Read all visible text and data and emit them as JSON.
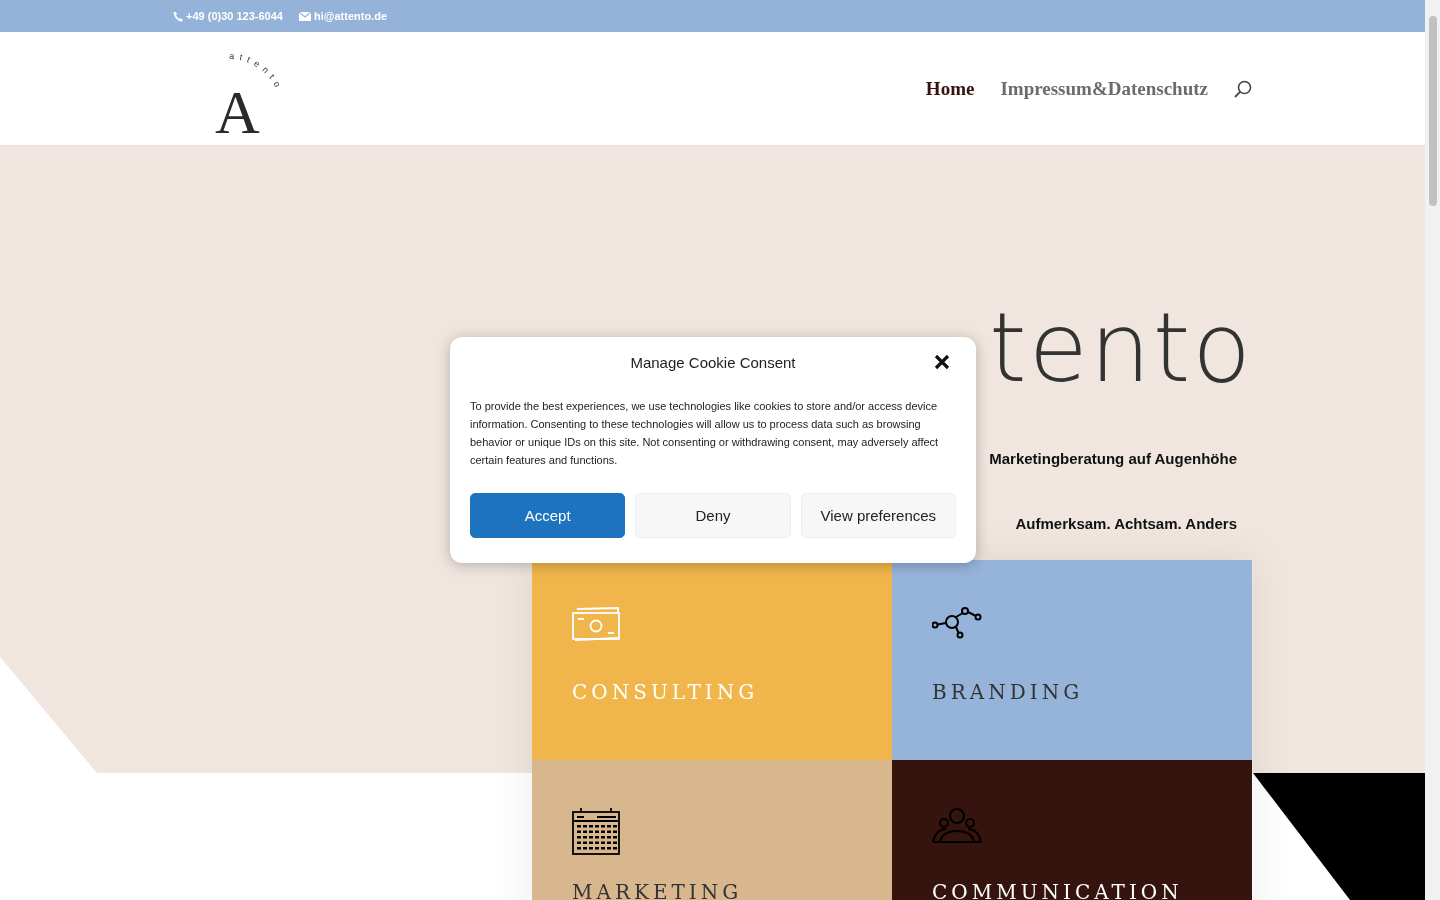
{
  "top_bar": {
    "phone": "+49 (0)30 123-6044",
    "email": "hi@attento.de"
  },
  "logo": {
    "letter": "A",
    "arc": "attento"
  },
  "nav": [
    {
      "label": "Home",
      "selected": true
    },
    {
      "label": "Impressum&Datenschutz",
      "selected": false
    }
  ],
  "hero": {
    "title": "tento",
    "subtitle": "Marketingberatung auf Augenhöhe",
    "tagline": "Aufmerksam. Achtsam. Anders"
  },
  "services": [
    {
      "label": "CONSULTING",
      "kind": "money",
      "color": "#f0b64b",
      "light_text": true
    },
    {
      "label": "BRANDING",
      "kind": "network",
      "color": "#96b3da",
      "light_text": false
    },
    {
      "label": "MARKETING",
      "kind": "calendar",
      "color": "#d8b78f",
      "light_text": false
    },
    {
      "label": "COMMUNICATION",
      "kind": "people",
      "color": "#35140e",
      "light_text": true
    }
  ],
  "cookie_dialog": {
    "title": "Manage Cookie Consent",
    "text": "To provide the best experiences, we use technologies like cookies to store and/or access device information. Consenting to these technologies will allow us to process data such as browsing behavior or unique IDs on this site. Not consenting or withdrawing consent, may adversely affect certain features and functions.",
    "buttons": [
      {
        "label": "Accept",
        "kind": "primary"
      },
      {
        "label": "Deny",
        "kind": "secondary"
      },
      {
        "label": "View preferences",
        "kind": "secondary"
      }
    ]
  }
}
